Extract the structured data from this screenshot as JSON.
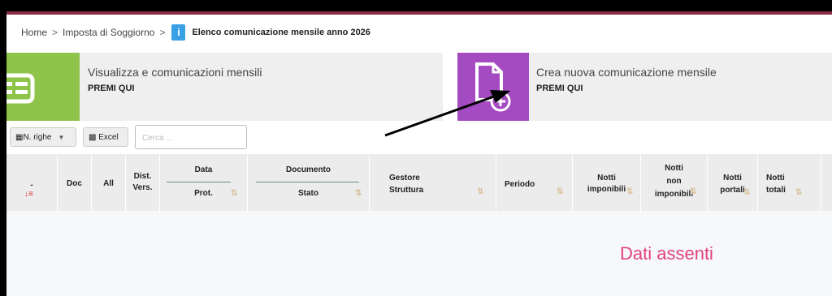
{
  "breadcrumb": {
    "home": "Home",
    "section": "Imposta di Soggiorno",
    "info_glyph": "i",
    "current": "Elenco comunicazione mensile anno 2026"
  },
  "tiles": [
    {
      "title": "Visualizza e comunicazioni mensili",
      "subtitle": "PREMI QUI",
      "icon": "list-icon",
      "color": "#8fc44a"
    },
    {
      "title": "Crea nuova comunicazione mensile",
      "subtitle": "PREMI QUI",
      "icon": "new-document-icon",
      "color": "#a54bc2"
    }
  ],
  "toolbar": {
    "rows_label": "N. righe",
    "excel_label": "Excel",
    "search_placeholder": "Cerca ..."
  },
  "table": {
    "columns": {
      "c0": "-",
      "doc": "Doc",
      "all": "All",
      "dist_a": "Dist.",
      "dist_b": "Vers.",
      "data": "Data",
      "prot": "Prot.",
      "documento": "Documento",
      "stato": "Stato",
      "gestore_a": "Gestore",
      "gestore_b": "Struttura",
      "periodo": "Periodo",
      "notti_imp_a": "Notti",
      "notti_imp_b": "imponibili",
      "notti_non_a": "Notti",
      "notti_non_b": "non",
      "notti_non_c": "imponibili",
      "notti_por_a": "Notti",
      "notti_por_b": "portali",
      "notti_tot_a": "Notti",
      "notti_tot_b": "totali"
    },
    "empty_message": "Dati assenti"
  }
}
